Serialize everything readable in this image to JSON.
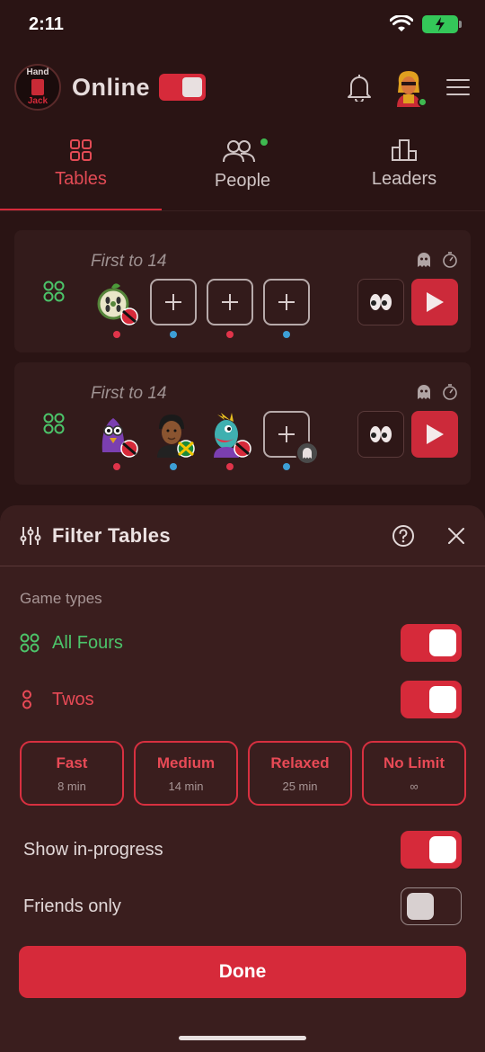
{
  "status_bar": {
    "time": "2:11"
  },
  "header": {
    "logo_line1": "Hand",
    "logo_line2": "Jack",
    "online_label": "Online",
    "online_enabled": true
  },
  "tabs": [
    {
      "label": "Tables",
      "active": true
    },
    {
      "label": "People",
      "active": false,
      "has_indicator": true
    },
    {
      "label": "Leaders",
      "active": false
    }
  ],
  "tables": [
    {
      "title": "First to 14",
      "game_type": "all-fours",
      "seats": [
        {
          "filled": true,
          "avatar": "cucumber-avatar-icon",
          "flag": "trinidad-flag",
          "team": "red"
        },
        {
          "filled": false,
          "team": "blue"
        },
        {
          "filled": false,
          "team": "red"
        },
        {
          "filled": false,
          "team": "blue"
        }
      ]
    },
    {
      "title": "First to 14",
      "game_type": "all-fours",
      "seats": [
        {
          "filled": true,
          "avatar": "purple-bird-avatar-icon",
          "flag": "trinidad-flag",
          "team": "red"
        },
        {
          "filled": true,
          "avatar": "person-avatar-icon",
          "flag": "jamaica-flag",
          "team": "blue"
        },
        {
          "filled": true,
          "avatar": "fish-avatar-icon",
          "flag": "trinidad-flag",
          "team": "red"
        },
        {
          "filled": false,
          "team": "blue",
          "ghost": true
        }
      ]
    }
  ],
  "filter": {
    "title": "Filter Tables",
    "section_label": "Game types",
    "game_types": [
      {
        "label": "All Fours",
        "enabled": true,
        "color": "#4cc46a"
      },
      {
        "label": "Twos",
        "enabled": true,
        "color": "#e84a56"
      }
    ],
    "speeds": [
      {
        "name": "Fast",
        "time": "8 min"
      },
      {
        "name": "Medium",
        "time": "14 min"
      },
      {
        "name": "Relaxed",
        "time": "25 min"
      },
      {
        "name": "No Limit",
        "time": "∞"
      }
    ],
    "show_in_progress": {
      "label": "Show in-progress",
      "enabled": true
    },
    "friends_only": {
      "label": "Friends only",
      "enabled": false
    },
    "done_label": "Done"
  },
  "colors": {
    "accent": "#d62a3a",
    "green": "#4cc46a",
    "background": "#2a1414"
  }
}
